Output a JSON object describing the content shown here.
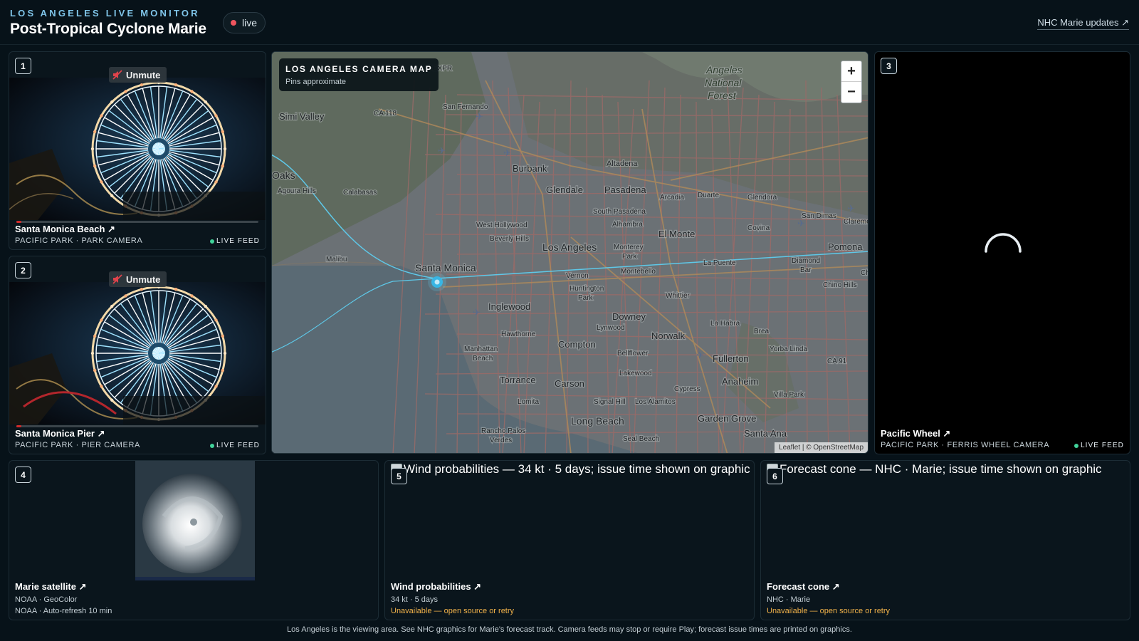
{
  "header": {
    "eyebrow": "LOS ANGELES LIVE MONITOR",
    "title": "Post-Tropical Cyclone Marie",
    "live_label": "live",
    "nhc_link": "NHC Marie updates ↗"
  },
  "cameras": [
    {
      "index": "1",
      "title": "Santa Monica Beach ↗",
      "subtitle": "PACIFIC PARK · PARK CAMERA",
      "unmute": "Unmute",
      "status": "LIVE FEED"
    },
    {
      "index": "2",
      "title": "Santa Monica Pier ↗",
      "subtitle": "PACIFIC PARK · PIER CAMERA",
      "unmute": "Unmute",
      "status": "LIVE FEED"
    },
    {
      "index": "3",
      "title": "Pacific Wheel ↗",
      "subtitle": "PACIFIC PARK · FERRIS WHEEL CAMERA",
      "status": "LIVE FEED"
    }
  ],
  "map": {
    "title": "LOS ANGELES CAMERA MAP",
    "subtitle": "Pins approximate",
    "zoom_in": "+",
    "zoom_out": "−",
    "attribution": "Leaflet | © OpenStreetMap",
    "labels": [
      "Simi Valley",
      "San Fernando",
      "CA 118",
      "Angeles National Forest",
      "Oaks",
      "Agoura Hills",
      "Calabasas",
      "Burbank",
      "Altadena",
      "Glendale",
      "Pasadena",
      "Arcadia",
      "Duarte",
      "Glendora",
      "San Dimas",
      "Claremont",
      "West Hollywood",
      "South Pasadena",
      "Alhambra",
      "Covina",
      "Beverly Hills",
      "El Monte",
      "Los Angeles",
      "Monterey Park",
      "Pomona",
      "Malibu",
      "Santa Monica",
      "Montebello",
      "La Puente",
      "Diamond Bar",
      "Vernon",
      "Huntington Park",
      "Whittier",
      "Chino Hills",
      "Chino",
      "Inglewood",
      "Downey",
      "La Habra",
      "Brea",
      "Hawthorne",
      "Lynwood",
      "Norwalk",
      "Yorba Linda",
      "Manhattan Beach",
      "Compton",
      "Bellflower",
      "Fullerton",
      "CA 91",
      "Torrance",
      "Carson",
      "Lakewood",
      "Cypress",
      "Anaheim",
      "Villa Park",
      "Lomita",
      "Signal Hill",
      "Los Alamitos",
      "Long Beach",
      "Garden Grove",
      "Rancho Palos Verdes",
      "Seal Beach",
      "Santa Ana",
      "14 EXPR"
    ]
  },
  "cards": [
    {
      "index": "4",
      "title": "Marie satellite ↗",
      "line1": "NOAA · GeoColor",
      "line2": "NOAA · Auto-refresh 10 min"
    },
    {
      "index": "5",
      "alt": "Wind probabilities — 34 kt · 5 days; issue time shown on graphic",
      "title": "Wind probabilities ↗",
      "line1": "34 kt · 5 days",
      "warning": "Unavailable — open source or retry"
    },
    {
      "index": "6",
      "alt": "Forecast cone — NHC · Marie; issue time shown on graphic",
      "title": "Forecast cone ↗",
      "line1": "NHC · Marie",
      "warning": "Unavailable — open source or retry"
    }
  ],
  "footer": "Los Angeles is the viewing area. See NHC graphics for Marie's forecast track. Camera feeds may stop or require Play; forecast issue times are printed on graphics.",
  "colors": {
    "background": "#071219",
    "accent": "#7fc4e8",
    "live_red": "#f0555e",
    "live_green": "#41d39a",
    "warning": "#f1b24a",
    "track": "#5ec8e8"
  },
  "icons": {
    "mute": "speaker-muted-icon",
    "external": "external-link-icon",
    "spinner": "loading-spinner-icon",
    "pin": "camera-pin-icon",
    "airport": "airport-icon"
  }
}
